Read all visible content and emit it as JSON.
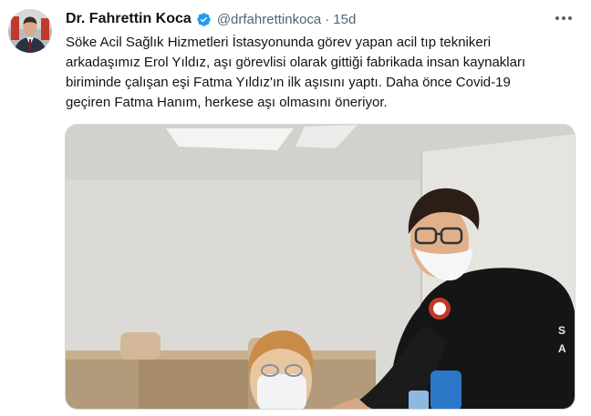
{
  "tweet": {
    "author_name": "Dr. Fahrettin Koca",
    "author_handle": "@drfahrettinkoca",
    "separator": "·",
    "timestamp": "15d",
    "text_lines": [
      "Söke Acil Sağlık Hizmetleri İstasyonunda görev yapan acil tıp teknikeri",
      "arkadaşımız Erol Yıldız, aşı görevlisi olarak gittiği fabrikada insan kaynakları",
      "biriminde çalışan eşi Fatma Yıldız'ın ilk aşısını yaptı. Daha önce Covid-19",
      "geçiren Fatma Hanım, herkese aşı olmasını öneriyor."
    ]
  },
  "colors": {
    "text_primary": "#0f1419",
    "text_secondary": "#536471",
    "verified_blue": "#1d9bf0",
    "border": "#cfd9de"
  },
  "icons": [
    "verified-badge-icon",
    "more-options-icon"
  ]
}
